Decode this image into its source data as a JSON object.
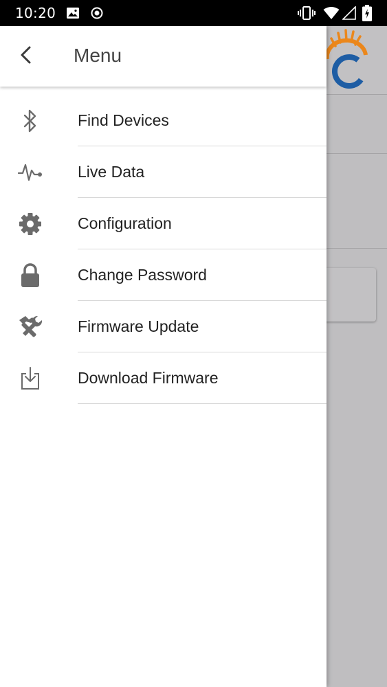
{
  "status_bar": {
    "time": "10:20",
    "left_icons": [
      "image-icon",
      "record-icon"
    ],
    "right_icons": [
      "vibrate-icon",
      "wifi-icon",
      "cell-signal-icon",
      "battery-charging-icon"
    ]
  },
  "drawer": {
    "title": "Menu",
    "back_icon": "chevron-left-icon",
    "items": [
      {
        "label": "Find Devices",
        "icon": "bluetooth-icon"
      },
      {
        "label": "Live Data",
        "icon": "pulse-icon"
      },
      {
        "label": "Configuration",
        "icon": "gear-icon"
      },
      {
        "label": "Change Password",
        "icon": "lock-icon"
      },
      {
        "label": "Firmware Update",
        "icon": "tools-icon"
      },
      {
        "label": "Download Firmware",
        "icon": "download-icon"
      }
    ]
  },
  "colors": {
    "drawer_bg": "#ffffff",
    "scrim": "#bdbcbe",
    "icon": "#6b6b6b",
    "logo_orange": "#f08a1c",
    "logo_blue": "#1f5fa8"
  }
}
